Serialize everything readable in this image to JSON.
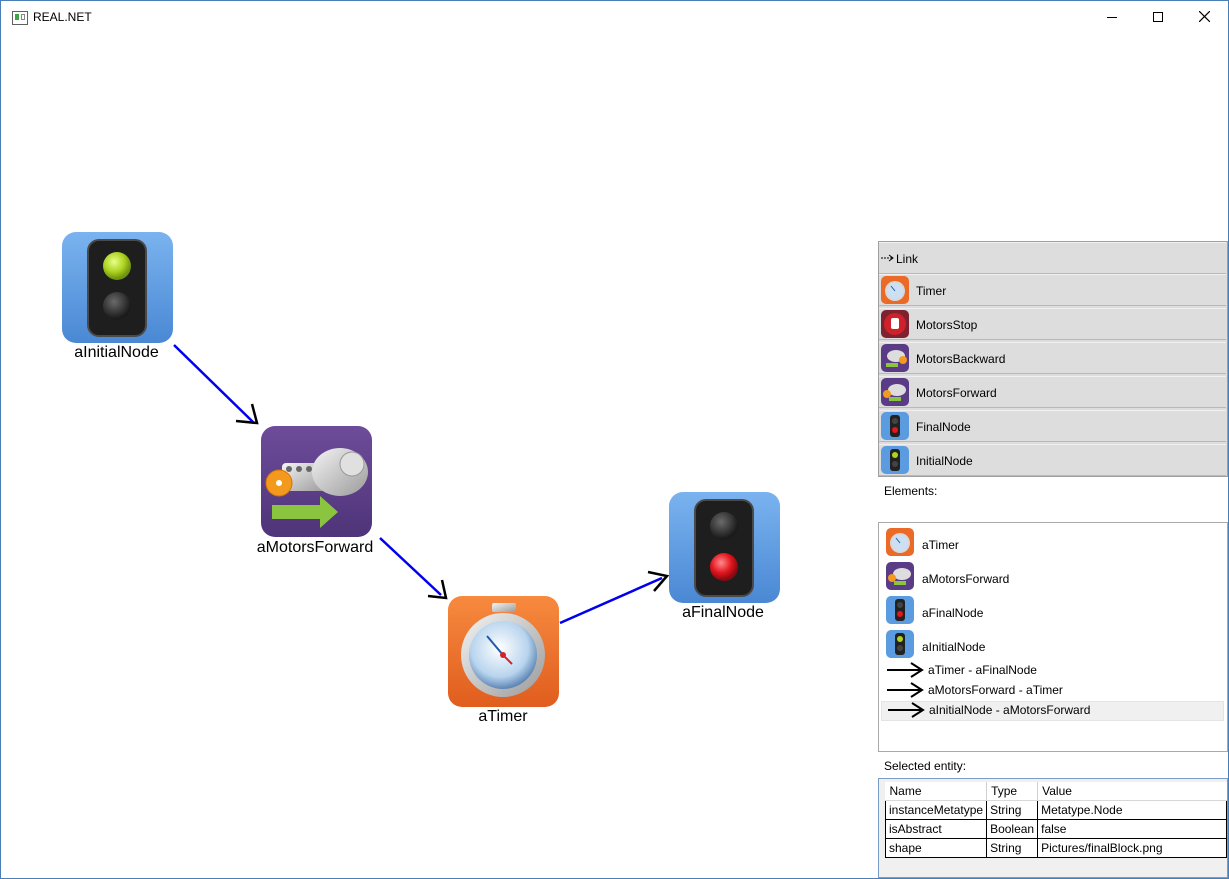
{
  "window": {
    "title": "REAL.NET"
  },
  "canvas": {
    "nodes": [
      {
        "id": "aInitialNode",
        "label": "aInitialNode",
        "kind": "initial"
      },
      {
        "id": "aMotorsForward",
        "label": "aMotorsForward",
        "kind": "motors-forward"
      },
      {
        "id": "aTimer",
        "label": "aTimer",
        "kind": "timer"
      },
      {
        "id": "aFinalNode",
        "label": "aFinalNode",
        "kind": "final"
      }
    ],
    "edge_color": "#0000ee"
  },
  "palette": {
    "items": [
      {
        "label": "Link",
        "icon": "link-arrow-icon"
      },
      {
        "label": "Timer",
        "icon": "timer-icon"
      },
      {
        "label": "MotorsStop",
        "icon": "stop-hand-icon"
      },
      {
        "label": "MotorsBackward",
        "icon": "motors-backward-icon"
      },
      {
        "label": "MotorsForward",
        "icon": "motors-forward-icon"
      },
      {
        "label": "FinalNode",
        "icon": "final-node-icon"
      },
      {
        "label": "InitialNode",
        "icon": "initial-node-icon"
      }
    ]
  },
  "elements": {
    "label": "Elements:",
    "items": [
      {
        "label": "aTimer",
        "icon": "timer-icon"
      },
      {
        "label": "aMotorsForward",
        "icon": "motors-forward-icon"
      },
      {
        "label": "aFinalNode",
        "icon": "final-node-icon"
      },
      {
        "label": "aInitialNode",
        "icon": "initial-node-icon"
      },
      {
        "label": "aTimer - aFinalNode",
        "icon": "link-arrow-icon"
      },
      {
        "label": "aMotorsForward - aTimer",
        "icon": "link-arrow-icon"
      },
      {
        "label": "aInitialNode - aMotorsForward",
        "icon": "link-arrow-icon",
        "selected": true
      }
    ]
  },
  "selected_entity": {
    "label": "Selected entity:",
    "columns": [
      "Name",
      "Type",
      "Value"
    ],
    "rows": [
      [
        "instanceMetatype",
        "String",
        "Metatype.Node"
      ],
      [
        "isAbstract",
        "Boolean",
        "false"
      ],
      [
        "shape",
        "String",
        "Pictures/finalBlock.png"
      ]
    ]
  },
  "colors": {
    "initial_bg": "#5b9be0",
    "final_bg": "#5b9be0",
    "motors_bg": "#5a3c86",
    "timer_bg": "#ec6a28"
  }
}
